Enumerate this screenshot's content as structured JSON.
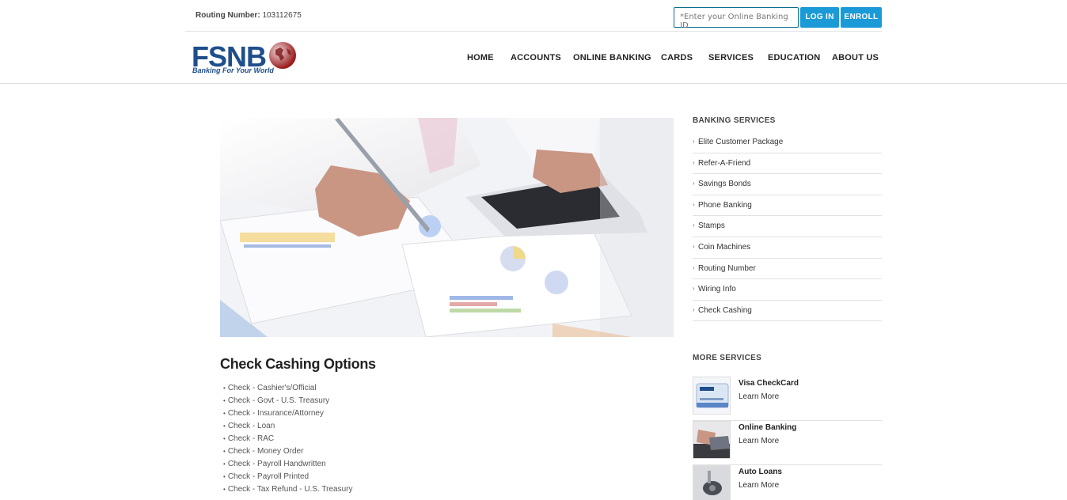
{
  "topbar": {
    "routing_label": "Routing Number:",
    "routing_value": "103112675",
    "login_placeholder": "*Enter your Online Banking ID",
    "login_button": "LOG IN",
    "enroll_button": "ENROLL"
  },
  "brand": {
    "logo_text": "FSNB",
    "tagline": "Banking For Your World",
    "primary_color": "#1f4e8c",
    "accent_color": "#9a1c1f",
    "button_color": "#1a9ad6"
  },
  "nav": [
    "HOME",
    "ACCOUNTS",
    "ONLINE BANKING",
    "CARDS",
    "SERVICES",
    "EDUCATION",
    "ABOUT US"
  ],
  "main": {
    "title": "Check Cashing Options",
    "options": [
      "Check - Cashier's/Official",
      "Check - Govt - U.S. Treasury",
      "Check - Insurance/Attorney",
      "Check - Loan",
      "Check - RAC",
      "Check - Money Order",
      "Check - Payroll Handwritten",
      "Check - Payroll Printed",
      "Check - Tax Refund - U.S. Treasury"
    ]
  },
  "sidebar": {
    "banking_heading": "BANKING SERVICES",
    "banking_items": [
      "Elite Customer Package",
      "Refer-A-Friend",
      "Savings Bonds",
      "Phone Banking",
      "Stamps",
      "Coin Machines",
      "Routing Number",
      "Wiring Info",
      "Check Cashing"
    ],
    "more_heading": "MORE SERVICES",
    "more_items": [
      {
        "title": "Visa CheckCard",
        "link": "Learn More",
        "icon": "card-thumbnail"
      },
      {
        "title": "Online Banking",
        "link": "Learn More",
        "icon": "laptop-thumbnail"
      },
      {
        "title": "Auto Loans",
        "link": "Learn More",
        "icon": "car-key-thumbnail"
      }
    ]
  }
}
